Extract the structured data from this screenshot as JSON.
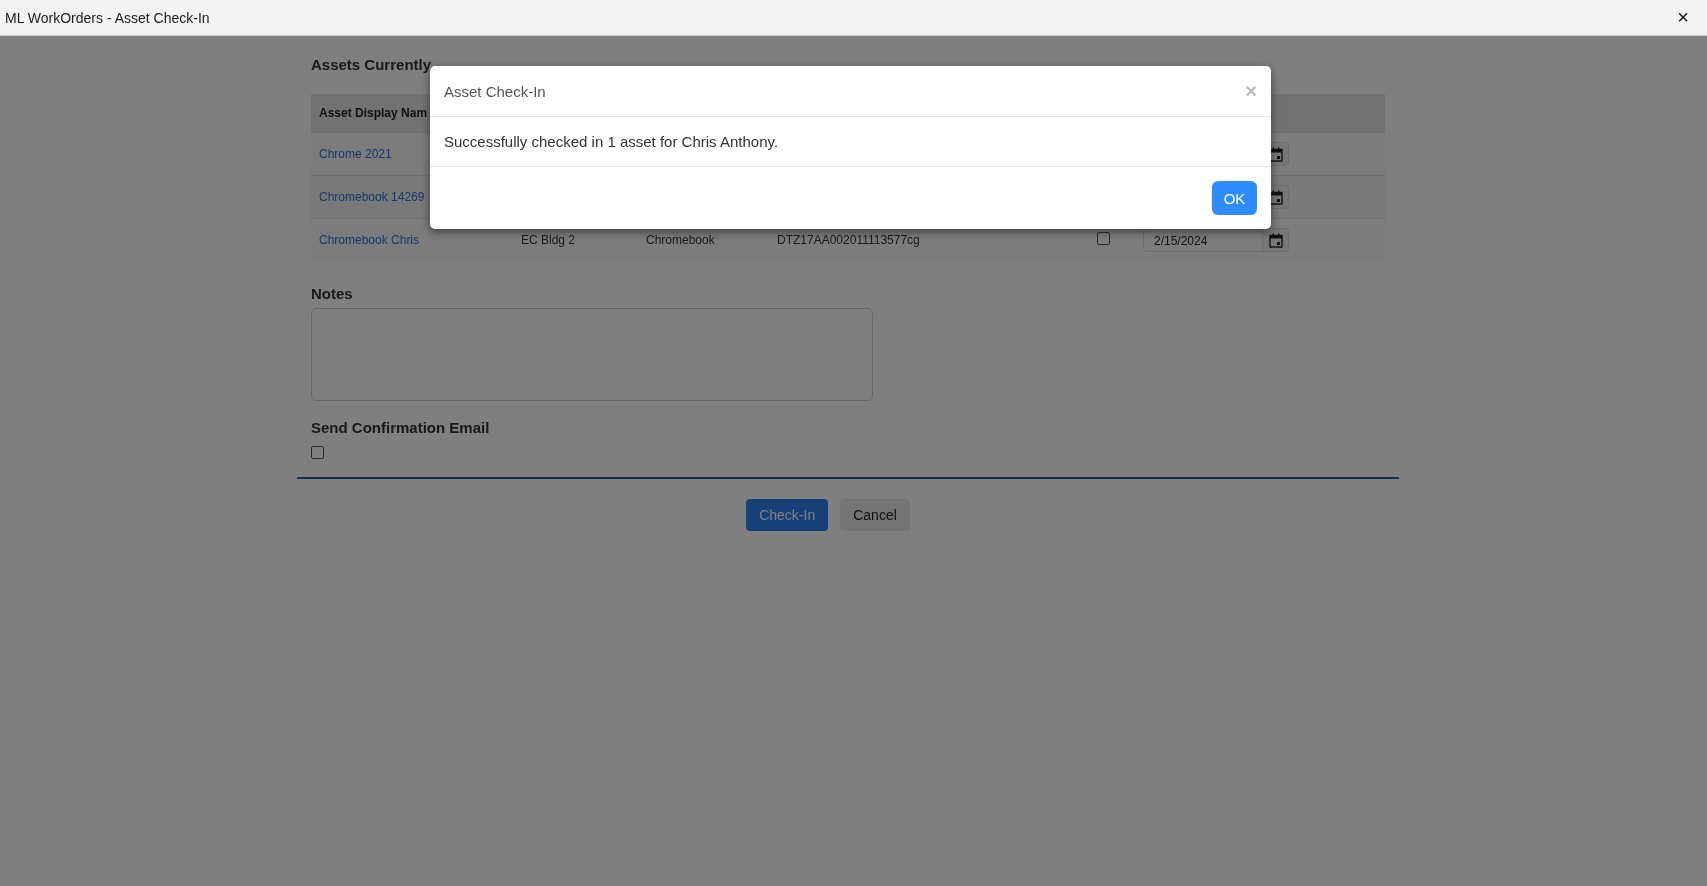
{
  "window": {
    "title": "ML WorkOrders - Asset Check-In",
    "close": "×"
  },
  "page": {
    "title": "Assets Currently"
  },
  "table": {
    "columns": [
      "Asset Display Nam"
    ],
    "rows": [
      {
        "name": "Chrome 2021"
      },
      {
        "name": "Chromebook 14269"
      },
      {
        "name": "Chromebook Chris",
        "location": "EC Bldg 2",
        "type": "Chromebook",
        "serial": "DTZ17AA002011113577cg",
        "checked": false,
        "date": "2/15/2024"
      }
    ]
  },
  "notes": {
    "label": "Notes"
  },
  "confirmation": {
    "label": "Send Confirmation Email",
    "checked": false
  },
  "buttons": [
    {
      "label": "Check-In",
      "kind": "primary"
    },
    {
      "label": "Cancel",
      "kind": "secondary"
    }
  ],
  "dialog": {
    "title": "Asset Check-In",
    "close": "×",
    "message": "Successfully checked in 1 asset for Chris Anthony.",
    "button": "OK"
  }
}
